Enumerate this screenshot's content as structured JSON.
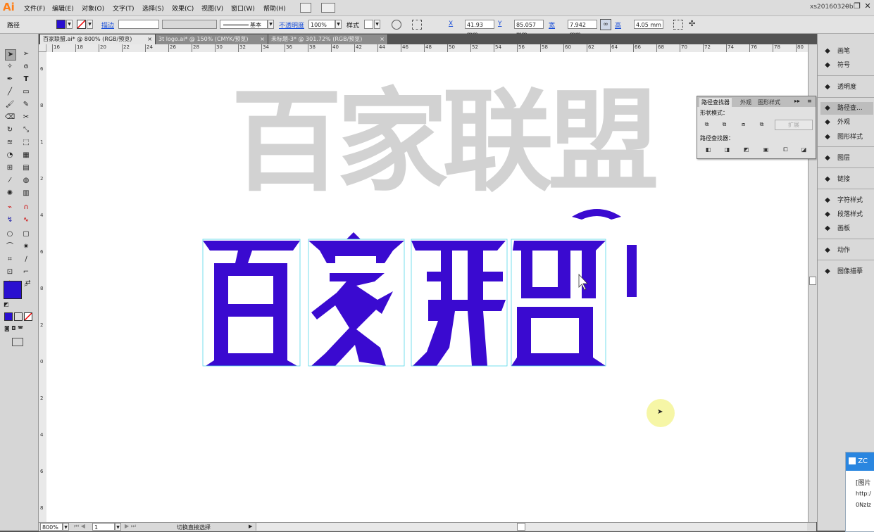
{
  "app": {
    "logo": "Ai",
    "user": "xs20160320b"
  },
  "menu": [
    "文件(F)",
    "编辑(E)",
    "对象(O)",
    "文字(T)",
    "选择(S)",
    "效果(C)",
    "视图(V)",
    "窗口(W)",
    "帮助(H)"
  ],
  "control": {
    "object_type": "路径",
    "stroke_label": "描边",
    "stroke_profile": "基本",
    "opacity_label": "不透明度",
    "opacity_value": "100%",
    "style_label": "样式",
    "x_label": "X",
    "x_value": "41.93 mm",
    "y_label": "Y",
    "y_value": "85.057 mm",
    "w_label": "宽",
    "w_value": "7.942 mm",
    "h_label": "高",
    "h_value": "4.05 mm",
    "fill_color": "#2a10d0"
  },
  "tabs": [
    {
      "label": "百家联盟.ai* @ 800% (RGB/预览)",
      "active": true
    },
    {
      "label": "3t logo.ai* @ 150% (CMYK/预览)",
      "active": false
    },
    {
      "label": "未标题-3* @ 301.72% (RGB/预览)",
      "active": false
    }
  ],
  "ruler_h": [
    "16",
    "18",
    "20",
    "22",
    "24",
    "26",
    "28",
    "30",
    "32",
    "34",
    "36",
    "38",
    "40",
    "42",
    "44",
    "46",
    "48",
    "50",
    "52",
    "54",
    "56",
    "58",
    "60",
    "62",
    "64",
    "66",
    "68",
    "70",
    "72",
    "74",
    "76",
    "78",
    "80"
  ],
  "ruler_v": [
    "6",
    "8",
    "1",
    "2",
    "4",
    "6",
    "8",
    "2",
    "0",
    "2",
    "4",
    "6",
    "8"
  ],
  "artwork": {
    "gray_text": "百家联盟",
    "gray_color": "#d2d2d2",
    "blue_text": "百家联盟",
    "blue_color": "#3a0ad0"
  },
  "pathfinder": {
    "tabs": [
      "路径查找器",
      "外观",
      "图形样式"
    ],
    "shape_modes_label": "形状模式：",
    "pathfinders_label": "路径查找器：",
    "expand_label": "扩展"
  },
  "dock": [
    {
      "label": "画笔",
      "icon": "brush-icon"
    },
    {
      "label": "符号",
      "icon": "club-icon"
    },
    {
      "label": "透明度",
      "icon": "transparency-icon"
    },
    {
      "label": "路径查...",
      "icon": "pathfinder-icon"
    },
    {
      "label": "外观",
      "icon": "appearance-icon"
    },
    {
      "label": "图形样式",
      "icon": "graphic-styles-icon"
    },
    {
      "label": "图层",
      "icon": "layers-icon"
    },
    {
      "label": "链接",
      "icon": "links-icon"
    },
    {
      "label": "字符样式",
      "icon": "char-style-icon"
    },
    {
      "label": "段落样式",
      "icon": "para-style-icon"
    },
    {
      "label": "画板",
      "icon": "artboard-icon"
    },
    {
      "label": "动作",
      "icon": "actions-icon"
    },
    {
      "label": "图像描摹",
      "icon": "image-trace-icon"
    }
  ],
  "status": {
    "zoom": "800%",
    "page": "1",
    "tool_hint": "切换直接选择"
  },
  "notify": {
    "title": "ZC",
    "line1": "[图片",
    "line2": "http:/",
    "line3": "0NzIz"
  }
}
